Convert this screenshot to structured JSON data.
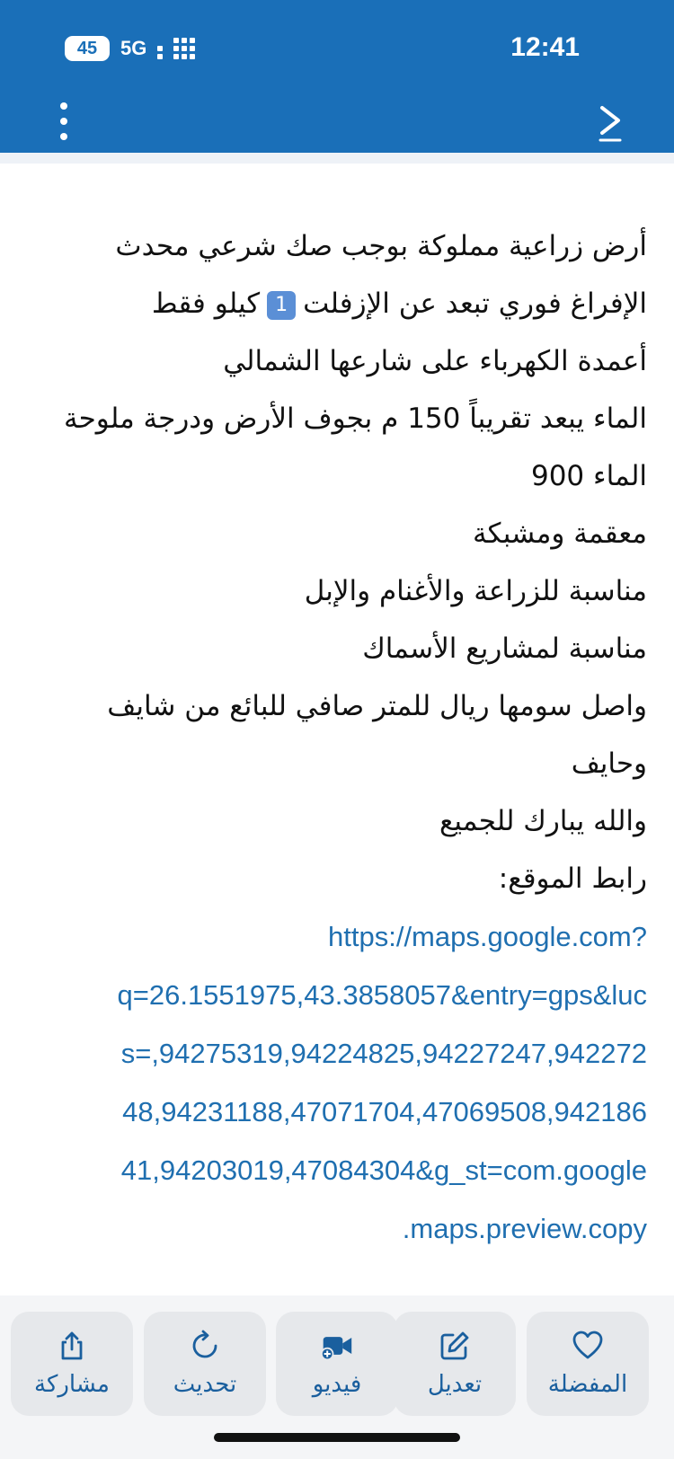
{
  "status": {
    "battery": "45",
    "network": "5G",
    "time": "12:41"
  },
  "header": {
    "menu_icon": "more-vertical-icon",
    "forward_icon": "chevron-right-icon"
  },
  "content": {
    "lines": [
      "أرض زراعية مملوكة بوجب صك شرعي محدث",
      "الإفراغ فوري تبعد عن الإزفلت",
      "أعمدة الكهرباء على شارعها الشمالي",
      "الماء يبعد تقريباً 150 م بجوف الأرض ودرجة ملوحة",
      "الماء 900",
      "معقمة ومشبكة",
      "مناسبة للزراعة والأغنام والإبل",
      "مناسبة لمشاريع الأسماك",
      "واصل سومها ريال للمتر صافي للبائع من شايف",
      "وحايف",
      "والله يبارك للجميع",
      "رابط الموقع:"
    ],
    "line2_badge": "1",
    "line2_suffix": "كيلو فقط",
    "link_lines": [
      "https://maps.google.com?",
      "q=26.1551975,43.3858057&entry=gps&luc",
      "s=,94275319,94224825,94227247,942272",
      "48,94231188,47071704,47069508,942186",
      "41,94203019,47084304&g_st=com.google",
      ".maps.preview.copy"
    ]
  },
  "actions": [
    {
      "label": "المفضلة",
      "icon": "heart-icon"
    },
    {
      "label": "تعديل",
      "icon": "edit-icon"
    },
    {
      "label": "فيديو",
      "icon": "video-add-icon"
    },
    {
      "label": "تحديث",
      "icon": "refresh-icon"
    },
    {
      "label": "مشاركة",
      "icon": "share-icon"
    }
  ],
  "colors": {
    "header": "#1a6fb8",
    "link": "#1f6fb0",
    "action_label": "#1a5f9e"
  }
}
